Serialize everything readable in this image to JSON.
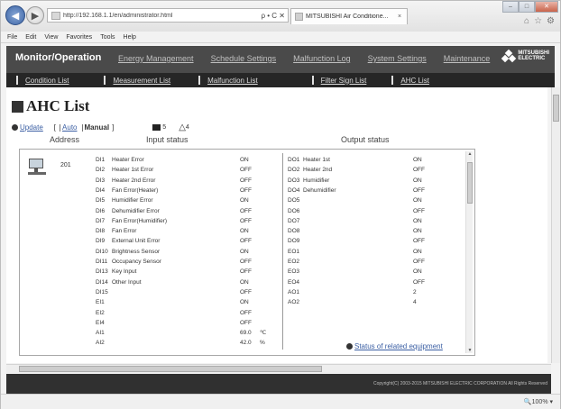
{
  "browser": {
    "url": "http://192.168.1.1/en/administrator.html",
    "address_controls": "ρ • C ✕",
    "tab_label": "MITSUBISHI Air Conditione...",
    "tab_close": "×",
    "menu": [
      "File",
      "Edit",
      "View",
      "Favorites",
      "Tools",
      "Help"
    ],
    "zoom": "🔍100%  ▾"
  },
  "app": {
    "title": "Monitor/Operation",
    "main_nav": [
      "Energy Management",
      "Schedule Settings",
      "Malfunction Log",
      "System Settings",
      "Maintenance"
    ],
    "sub_nav": [
      "Condition List",
      "Measurement List",
      "Malfunction List",
      "Filter Sign List",
      "AHC List"
    ],
    "logo_line1": "MITSUBISHI",
    "logo_line2": "ELECTRIC",
    "footer": "Copyright(C) 2003-2015 MITSUBISHI ELECTRIC CORPORATION All Rights Reserved"
  },
  "page": {
    "title": "AHC List",
    "update": "Update",
    "mode_open": "[",
    "auto": "Auto",
    "manual": "Manual",
    "mode_close": "]",
    "count_normal": "5",
    "count_warning": "4",
    "col_address": "Address",
    "col_input": "Input status",
    "col_output": "Output status",
    "related": "Status of related equipment"
  },
  "device": {
    "address": "201",
    "inputs": [
      {
        "id": "DI1",
        "name": "Heater Error",
        "value": "ON"
      },
      {
        "id": "DI2",
        "name": "Heater 1st Error",
        "value": "OFF"
      },
      {
        "id": "DI3",
        "name": "Heater 2nd Error",
        "value": "OFF"
      },
      {
        "id": "DI4",
        "name": "Fan Error(Heater)",
        "value": "OFF"
      },
      {
        "id": "DI5",
        "name": "Humidifier Error",
        "value": "ON"
      },
      {
        "id": "DI6",
        "name": "Dehumidifier Error",
        "value": "OFF"
      },
      {
        "id": "DI7",
        "name": "Fan Error(Humidifier)",
        "value": "OFF"
      },
      {
        "id": "DI8",
        "name": "Fan Error",
        "value": "ON"
      },
      {
        "id": "DI9",
        "name": "External Unit Error",
        "value": "OFF"
      },
      {
        "id": "DI10",
        "name": "Brightness Sensor",
        "value": "ON"
      },
      {
        "id": "DI11",
        "name": "Occupancy Sensor",
        "value": "OFF"
      },
      {
        "id": "DI13",
        "name": "Key Input",
        "value": "OFF"
      },
      {
        "id": "DI14",
        "name": "Other Input",
        "value": "ON"
      },
      {
        "id": "DI15",
        "name": "",
        "value": "OFF"
      },
      {
        "id": "EI1",
        "name": "",
        "value": "ON"
      },
      {
        "id": "EI2",
        "name": "",
        "value": "OFF"
      },
      {
        "id": "EI4",
        "name": "",
        "value": "OFF"
      },
      {
        "id": "AI1",
        "name": "",
        "value": "69.0",
        "unit": "℃"
      },
      {
        "id": "AI2",
        "name": "",
        "value": "42.0",
        "unit": "%"
      }
    ],
    "outputs": [
      {
        "id": "DO1",
        "name": "Heater 1st",
        "value": "ON"
      },
      {
        "id": "DO2",
        "name": "Heater 2nd",
        "value": "OFF"
      },
      {
        "id": "DO3",
        "name": "Humidifier",
        "value": "ON"
      },
      {
        "id": "DO4",
        "name": "Dehumidifier",
        "value": "OFF"
      },
      {
        "id": "DO5",
        "name": "",
        "value": "ON"
      },
      {
        "id": "DO6",
        "name": "",
        "value": "OFF"
      },
      {
        "id": "DO7",
        "name": "",
        "value": "ON"
      },
      {
        "id": "DO8",
        "name": "",
        "value": "ON"
      },
      {
        "id": "DO9",
        "name": "",
        "value": "OFF"
      },
      {
        "id": "EO1",
        "name": "",
        "value": "ON"
      },
      {
        "id": "EO2",
        "name": "",
        "value": "OFF"
      },
      {
        "id": "EO3",
        "name": "",
        "value": "ON"
      },
      {
        "id": "EO4",
        "name": "",
        "value": "OFF"
      },
      {
        "id": "AO1",
        "name": "",
        "value": "2"
      },
      {
        "id": "AO2",
        "name": "",
        "value": "4"
      }
    ]
  }
}
